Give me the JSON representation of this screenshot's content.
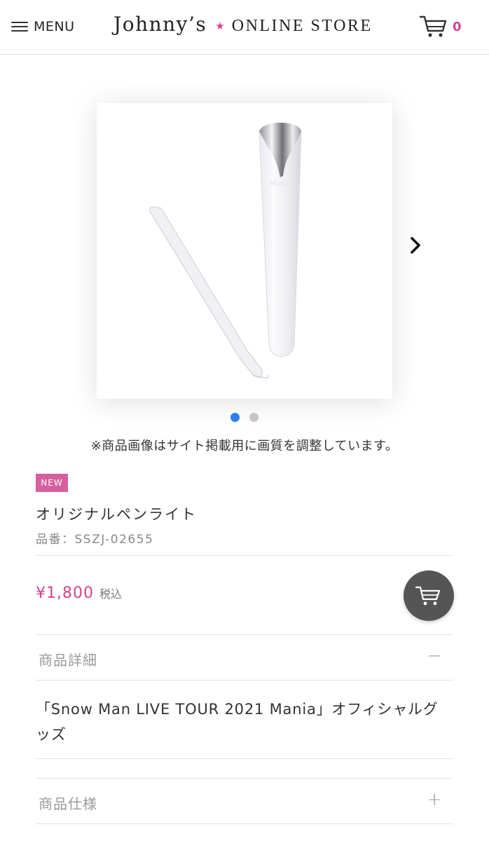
{
  "header": {
    "menu_label": "MENU",
    "logo_main": "Johnny’s",
    "logo_star": "★",
    "logo_sub": "ONLINE STORE",
    "cart_count": "0"
  },
  "gallery": {
    "image_alt": "オリジナルペンライト",
    "dots_total": 2,
    "active_dot": 1,
    "notice": "※商品画像はサイト掲載用に画質を調整しています。"
  },
  "product": {
    "badge": "NEW",
    "name": "オリジナルペンライト",
    "code": "品番：SSZJ-02655",
    "price": "¥1,800",
    "tax_label": "税込"
  },
  "details": {
    "title": "商品詳細",
    "toggle": "−",
    "description": "「Snow Man LIVE TOUR 2021 Mania」オフィシャルグッズ"
  },
  "specs": {
    "title": "商品仕様",
    "toggle": "+"
  },
  "colors": {
    "accent": "#d4448e",
    "badge": "#d65fa0",
    "active_dot": "#2e7ee8",
    "cart_button": "#555555"
  }
}
